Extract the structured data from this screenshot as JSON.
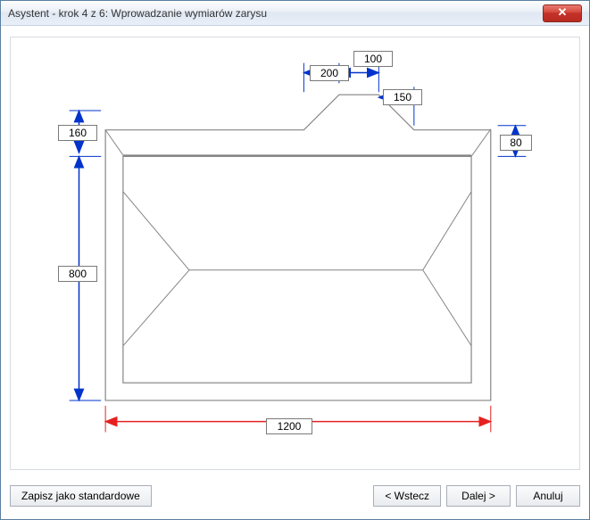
{
  "window": {
    "title": "Asystent - krok 4 z 6: Wprowadzanie wymiarów zarysu"
  },
  "dimensions": {
    "ridge_left_slope": "200",
    "ridge_flat": "100",
    "ridge_right_slope": "150",
    "ridge_height": "80",
    "top_offset": "160",
    "height": "800",
    "width": "1200"
  },
  "buttons": {
    "save_standard": "Zapisz jako standardowe",
    "back": "< Wstecz",
    "next": "Dalej >",
    "cancel": "Anuluj"
  }
}
